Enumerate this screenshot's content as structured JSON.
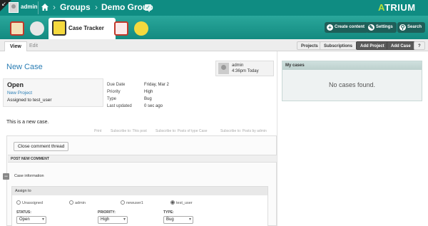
{
  "topbar": {
    "user": "admin",
    "breadcrumb": [
      "Groups",
      "Demo Group"
    ],
    "logo_text": "TRIUM",
    "logo_letter": "A"
  },
  "appbar": {
    "active_app": "Case Tracker",
    "buttons": {
      "create_content": "Create content",
      "settings": "Settings",
      "search": "Search"
    }
  },
  "tabs": {
    "view": "View",
    "edit": "Edit",
    "projects": "Projects",
    "subscriptions": "Subscriptions",
    "add_project": "Add Project",
    "add_case": "Add Case",
    "help": "?"
  },
  "case": {
    "title": "New Case",
    "author": "admin",
    "time": "4:36pm Today",
    "status": "Open",
    "project": "New Project",
    "assigned": "Assigned to test_user",
    "meta": [
      {
        "label": "Due Date",
        "value": "Friday, Mar 2"
      },
      {
        "label": "Priority",
        "value": "High"
      },
      {
        "label": "Type",
        "value": "Bug"
      },
      {
        "label": "Last updated",
        "value": "0 sec ago"
      }
    ],
    "body": "This is a new case.",
    "links": [
      "Print",
      "Subscribe to: This post",
      "Subscribe to: Posts of type Case",
      "Subscribe to: Posts by admin"
    ]
  },
  "comment": {
    "close_thread": "Close comment thread",
    "post_new": "POST NEW COMMENT",
    "case_information": "Case information",
    "assign_to": "Assign to",
    "assignees": [
      "Unassigned",
      "admin",
      "newuser1",
      "test_user"
    ],
    "selected_assignee": "test_user",
    "status_label": "STATUS:",
    "priority_label": "PRIORITY:",
    "type_label": "TYPE:",
    "status_value": "Open",
    "priority_value": "High",
    "type_value": "Bug"
  },
  "sidebar": {
    "title": "My cases",
    "empty": "No cases found."
  },
  "colors": {
    "topbar": "#0f8c82",
    "appbar": "#2aa79b",
    "link": "#2a7db4",
    "logo_accent": "#b8e03a"
  }
}
